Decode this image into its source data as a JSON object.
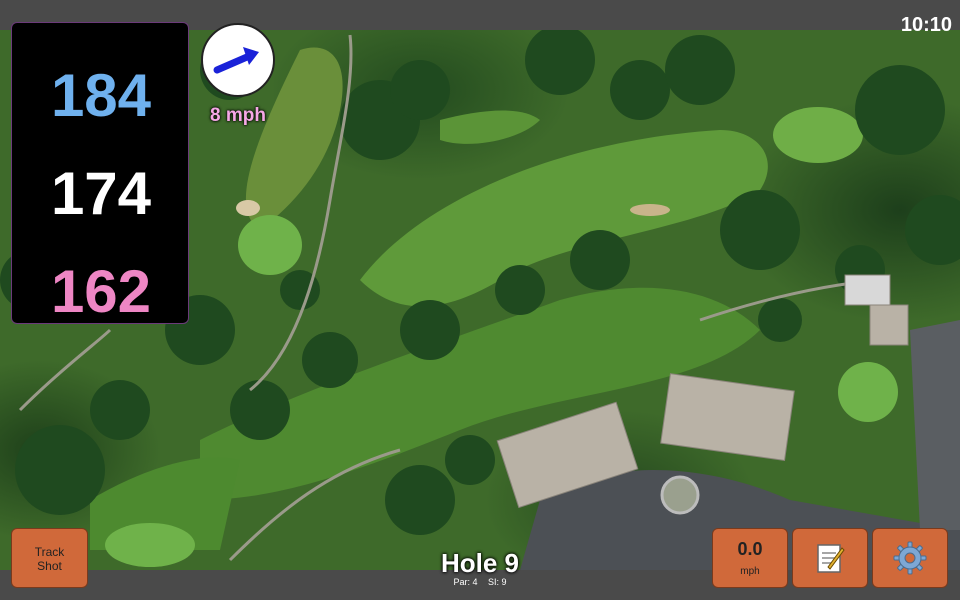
{
  "status": {
    "time": "10:10"
  },
  "distances": {
    "back": "184",
    "center": "174",
    "front": "162"
  },
  "wind": {
    "speed": "8 mph",
    "direction_icon": "arrow-icon"
  },
  "hole": {
    "title": "Hole 9",
    "par": "Par: 4",
    "stroke_index": "SI: 9"
  },
  "buttons": {
    "track_shot": [
      "Track",
      "Shot"
    ],
    "speed_value": "0.0",
    "speed_unit": "mph",
    "notes_icon": "notepad-icon",
    "settings_icon": "gear-icon"
  },
  "colors": {
    "back": "#6fb1ee",
    "center": "#ffffff",
    "front": "#ee86c4",
    "button": "#d0693a",
    "wind_text": "#f6a8e6"
  }
}
